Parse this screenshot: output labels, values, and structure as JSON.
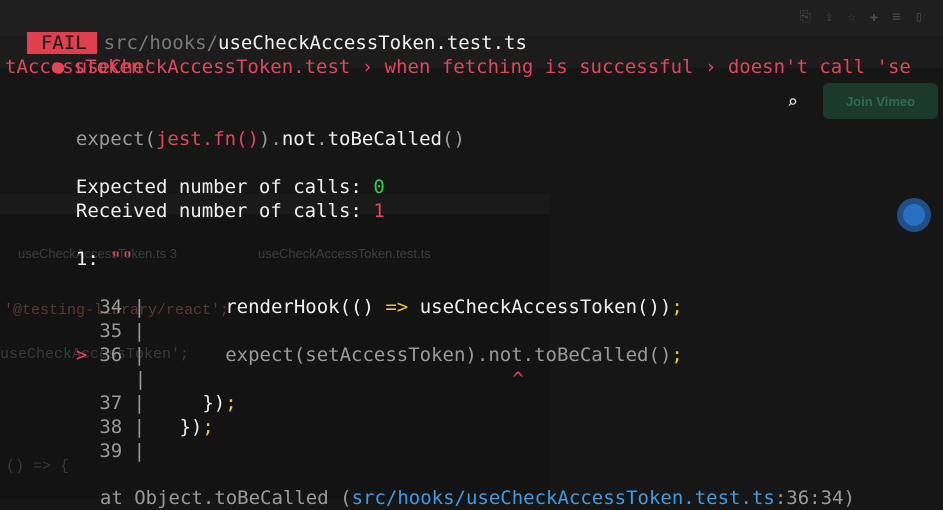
{
  "fail_badge": "FAIL",
  "file_path": {
    "dir": "src/hooks/",
    "file": "useCheckAccessToken.test.ts"
  },
  "test_title": {
    "bullet": "●",
    "line1": "useCheckAccessToken.test › when fetching is successful › doesn't call 'se",
    "line2": "tAccessToken'"
  },
  "assertion": {
    "expect": "expect(",
    "received": "jest.fn()",
    "close": ")",
    "dot1": ".",
    "not": "not",
    "dot2": ".",
    "matcher": "toBeCalled",
    "args": "()"
  },
  "expected_calls": {
    "label": "Expected number of calls: ",
    "value": "0"
  },
  "received_calls": {
    "label": "Received number of calls: ",
    "value": "1"
  },
  "call_list": {
    "index": "1: ",
    "value": "\"\""
  },
  "code_frame": [
    {
      "marker": " ",
      "num": "34",
      "sep": " |",
      "code": "      renderHook(() => useCheckAccessToken());"
    },
    {
      "marker": " ",
      "num": "35",
      "sep": " |",
      "code": ""
    },
    {
      "marker": ">",
      "num": "36",
      "sep": " |",
      "code": "      expect(setAccessToken).not.toBeCalled();"
    },
    {
      "marker": " ",
      "num": "",
      "sep": "  |",
      "code": "                                ^"
    },
    {
      "marker": " ",
      "num": "37",
      "sep": " |",
      "code": "    });"
    },
    {
      "marker": " ",
      "num": "38",
      "sep": " |",
      "code": "  });"
    },
    {
      "marker": " ",
      "num": "39",
      "sep": " |",
      "code": ""
    }
  ],
  "stack_trace": {
    "prefix": "at Object.toBeCalled (",
    "path": "src/hooks/useCheckAccessToken.test.ts",
    "position": ":36:34",
    "suffix": ")"
  },
  "background": {
    "join_button": "Join Vimeo",
    "tab1": "useCheckAccessToken.ts 3",
    "tab2": "useCheckAccessToken.test.ts",
    "ghost_import": "'@testing-library/react';",
    "ghost_hook": "useCheckAccessToken';",
    "ghost_arrow": "() => {"
  },
  "colors": {
    "fail_red": "#e13f4f",
    "pass_green": "#37c946",
    "link_blue": "#3f9be4",
    "terminal_bg": "#161616"
  }
}
